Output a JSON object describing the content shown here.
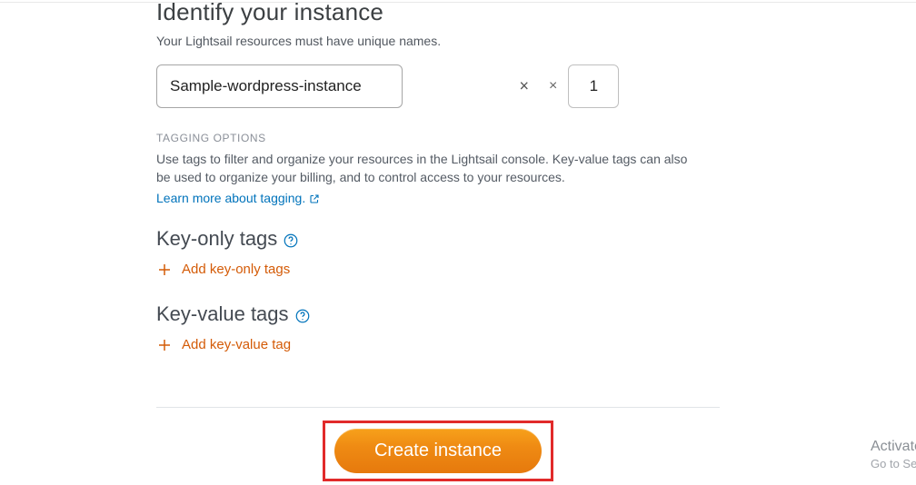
{
  "header": {
    "title": "Identify your instance",
    "subtitle": "Your Lightsail resources must have unique names."
  },
  "name": {
    "value": "Sample-wordpress-instance",
    "count": "1",
    "clear_symbol": "×",
    "mult_symbol": "×"
  },
  "tagging": {
    "label": "TAGGING OPTIONS",
    "description": "Use tags to filter and organize your resources in the Lightsail console. Key-value tags can also be used to organize your billing, and to control access to your resources.",
    "learn_more": "Learn more about tagging."
  },
  "key_only": {
    "heading": "Key-only tags",
    "add_label": "Add key-only tags"
  },
  "key_value": {
    "heading": "Key-value tags",
    "add_label": "Add key-value tag"
  },
  "actions": {
    "create": "Create instance"
  },
  "side": {
    "line1": "Activate Windows",
    "line2": "Go to Settings"
  }
}
